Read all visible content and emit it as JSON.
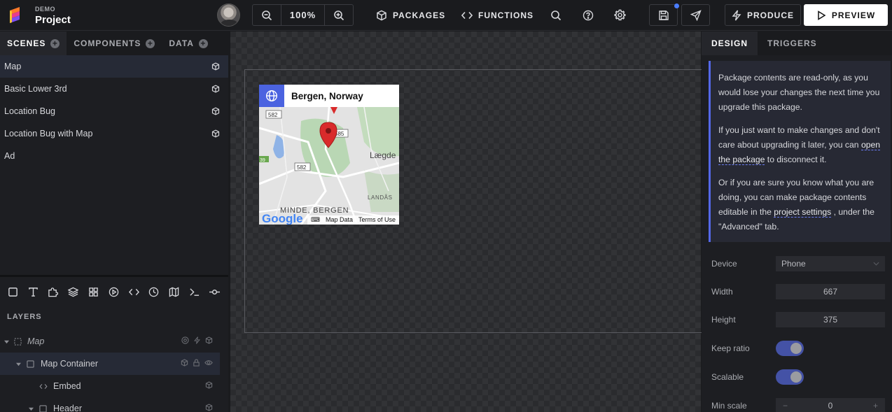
{
  "header": {
    "project_kicker": "DEMO",
    "project_name": "Project",
    "zoom": "100%",
    "packages_label": "PACKAGES",
    "functions_label": "FUNCTIONS",
    "produce_label": "PRODUCE",
    "preview_label": "PREVIEW"
  },
  "left_tabs": [
    {
      "label": "SCENES"
    },
    {
      "label": "COMPONENTS"
    },
    {
      "label": "DATA"
    }
  ],
  "scenes": [
    {
      "label": "Map"
    },
    {
      "label": "Basic Lower 3rd"
    },
    {
      "label": "Location Bug"
    },
    {
      "label": "Location Bug with Map"
    },
    {
      "label": "Ad"
    }
  ],
  "layers": {
    "title": "LAYERS",
    "items": [
      {
        "label": "Map"
      },
      {
        "label": "Map Container"
      },
      {
        "label": "Embed"
      },
      {
        "label": "Header"
      }
    ]
  },
  "canvas": {
    "widget_title": "Bergen, Norway",
    "map_labels": {
      "road_582a": "582",
      "road_585": "585",
      "road_582b": "582",
      "road_39": "39",
      "lagdene": "Lægde",
      "minde": "MINDE, BERGEN",
      "landas": "LANDÅS",
      "google": "Google"
    },
    "map_data_label": "Map Data",
    "terms_label": "Terms of Use"
  },
  "right_tabs": [
    {
      "label": "DESIGN"
    },
    {
      "label": "TRIGGERS"
    }
  ],
  "notice": {
    "p1": "Package contents are read-only, as you would lose your changes the next time you upgrade this package.",
    "p2_before": "If you just want to make changes and don't care about upgrading it later, you can ",
    "p2_link": "open the package",
    "p2_after": " to disconnect it.",
    "p3_before": "Or if you are sure you know what you are doing, you can make package contents editable in the ",
    "p3_link": "project settings",
    "p3_after": " , under the \"Advanced\" tab."
  },
  "props": {
    "device_label": "Device",
    "device_value": "Phone",
    "width_label": "Width",
    "width_value": "667",
    "height_label": "Height",
    "height_value": "375",
    "keep_ratio_label": "Keep ratio",
    "keep_ratio_on": true,
    "scalable_label": "Scalable",
    "scalable_on": true,
    "min_scale_label": "Min scale",
    "min_scale_value": "0",
    "minus": "−",
    "plus": "+"
  },
  "colors": {
    "accent": "#4b63e0",
    "notice_border": "#5468e8",
    "toggle_on": "#4452a6",
    "pin": "#d92b2b",
    "unsaved_dot": "#4a7dff"
  }
}
